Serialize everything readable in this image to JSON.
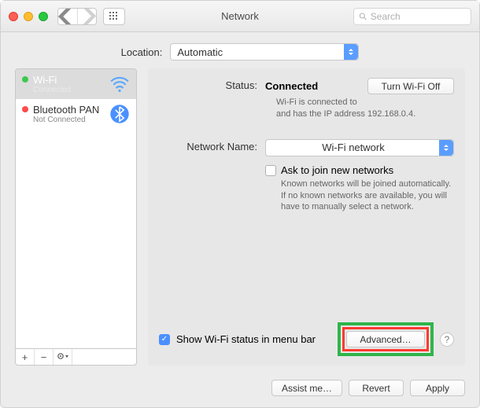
{
  "window": {
    "title": "Network"
  },
  "search": {
    "placeholder": "Search"
  },
  "location": {
    "label": "Location:",
    "value": "Automatic"
  },
  "services": [
    {
      "name": "Wi-Fi",
      "status": "Connected",
      "dot": "green",
      "selected": true,
      "icon": "wifi"
    },
    {
      "name": "Bluetooth PAN",
      "status": "Not Connected",
      "dot": "red",
      "selected": false,
      "icon": "bluetooth"
    }
  ],
  "main": {
    "status_label": "Status:",
    "status_value": "Connected",
    "wifi_toggle": "Turn Wi-Fi Off",
    "status_detail": "Wi-Fi is connected to\nand has the IP address 192.168.0.4.",
    "netname_label": "Network Name:",
    "netname_value": "Wi-Fi network",
    "askjoin_label": "Ask to join new networks",
    "askjoin_detail": "Known networks will be joined automatically. If no known networks are available, you will have to manually select a network.",
    "showstatus_label": "Show Wi-Fi status in menu bar",
    "advanced": "Advanced…"
  },
  "footer": {
    "assist": "Assist me…",
    "revert": "Revert",
    "apply": "Apply"
  }
}
